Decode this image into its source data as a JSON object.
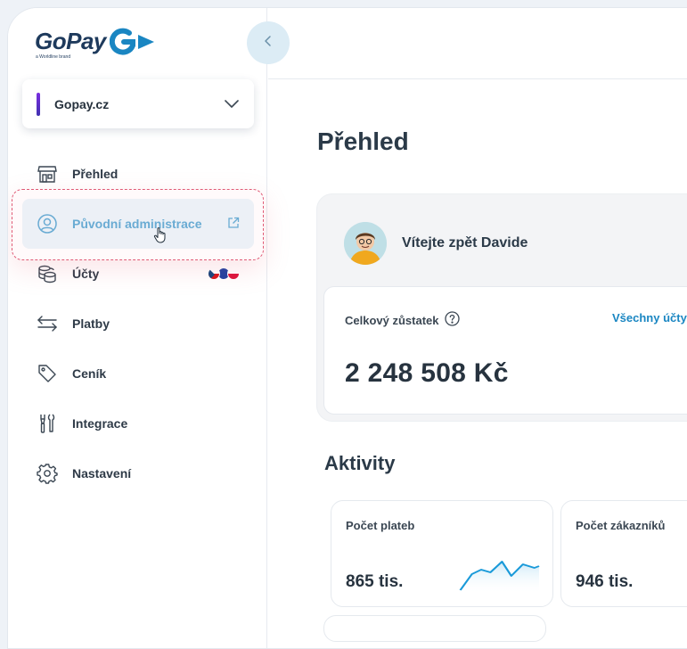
{
  "brand": {
    "logo_text": "GoPay",
    "logo_sub": "a Worldline brand"
  },
  "shop_selector": {
    "value": "Gopay.cz"
  },
  "nav": {
    "items": [
      {
        "label": "Přehled"
      },
      {
        "label": "Původní administrace"
      },
      {
        "label": "Účty"
      },
      {
        "label": "Platby"
      },
      {
        "label": "Ceník"
      },
      {
        "label": "Integrace"
      },
      {
        "label": "Nastavení"
      }
    ]
  },
  "main": {
    "title": "Přehled",
    "welcome": "Vítejte zpět Davide",
    "balance": {
      "label": "Celkový zůstatek",
      "all_accounts_link": "Všechny účty",
      "value": "2 248 508 Kč"
    },
    "activities": {
      "title": "Aktivity",
      "cards": [
        {
          "label": "Počet plateb",
          "value": "865 tis."
        },
        {
          "label": "Počet zákazníků",
          "value": "946 tis."
        }
      ]
    }
  },
  "colors": {
    "accent": "#1a86c2",
    "active_bg": "#e2f0f7",
    "highlight_border": "#e05a75",
    "logo": "#1e3a5c"
  }
}
